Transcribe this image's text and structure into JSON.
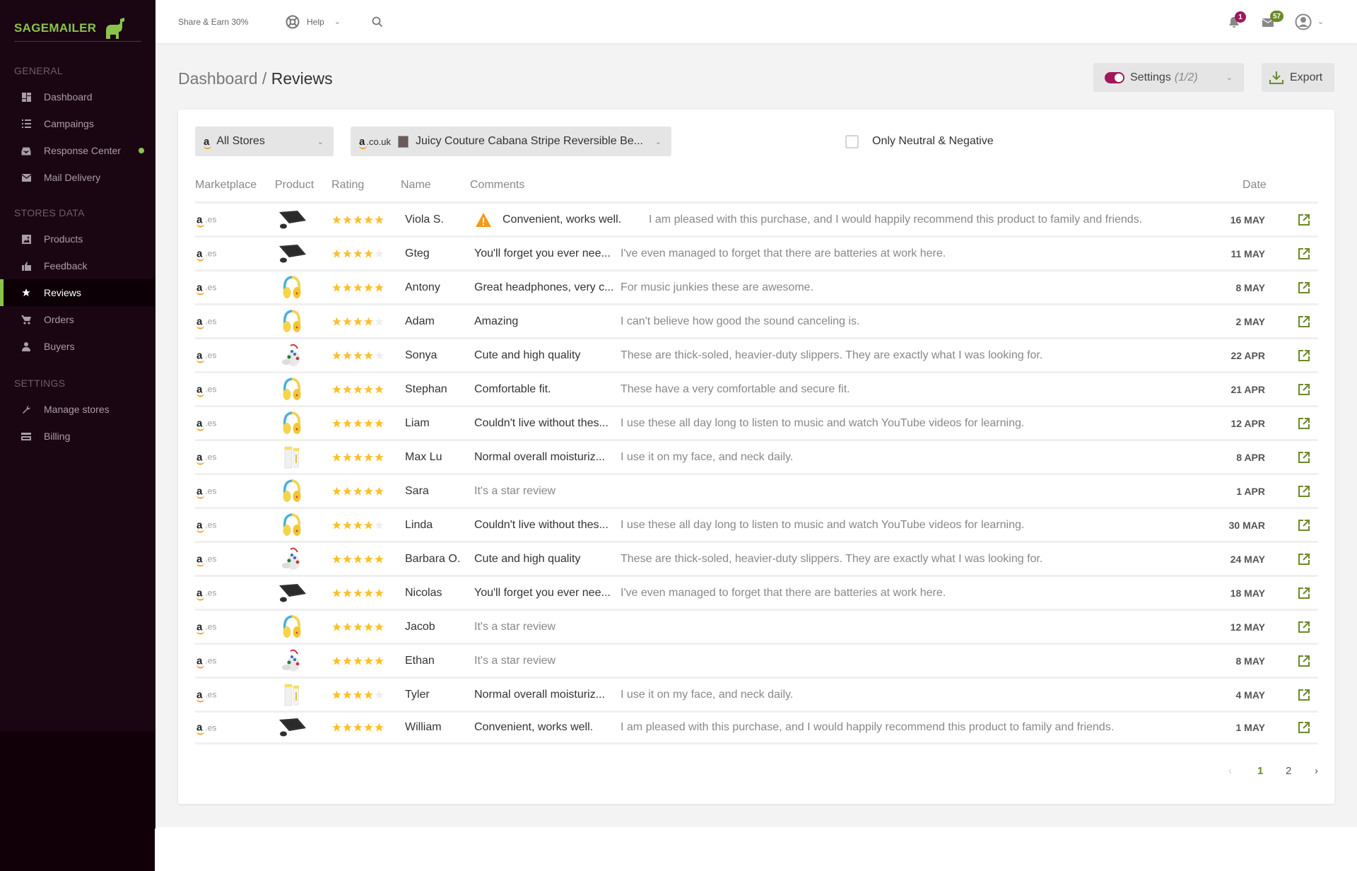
{
  "app": {
    "brand": "SAGEMAILER"
  },
  "sidebar": {
    "sections": [
      {
        "label": "GENERAL",
        "items": [
          {
            "label": "Dashboard",
            "icon": "dashboard-icon"
          },
          {
            "label": "Campaings",
            "icon": "list-icon"
          },
          {
            "label": "Response Center",
            "icon": "inbox-icon",
            "status_dot": true
          },
          {
            "label": "Mail Delivery",
            "icon": "mail-icon"
          }
        ]
      },
      {
        "label": "STORES DATA",
        "items": [
          {
            "label": "Products",
            "icon": "image-icon"
          },
          {
            "label": "Feedback",
            "icon": "thumbs-up-icon"
          },
          {
            "label": "Reviews",
            "icon": "star-icon",
            "active": true
          },
          {
            "label": "Orders",
            "icon": "cart-icon"
          },
          {
            "label": "Buyers",
            "icon": "person-icon"
          }
        ]
      },
      {
        "label": "SETTINGS",
        "items": [
          {
            "label": "Manage stores",
            "icon": "wrench-icon"
          },
          {
            "label": "Billing",
            "icon": "credit-card-icon"
          }
        ]
      }
    ]
  },
  "topbar": {
    "share_label": "Share & Earn 30%",
    "help_label": "Help",
    "notifications_count": "1",
    "messages_count": "57",
    "colors": {
      "notifications_badge": "#a0185a",
      "messages_badge": "#6a8a2a"
    }
  },
  "header": {
    "breadcrumb_parent": "Dashboard",
    "separator": " / ",
    "page_title": "Reviews",
    "settings_label": "Settings",
    "settings_count": "(1/2)",
    "settings_toggle_on": true,
    "export_label": "Export"
  },
  "filters": {
    "store_select": {
      "value": "All Stores"
    },
    "product_select": {
      "marketplace": ".co.uk",
      "value": "Juicy Couture Cabana Stripe Reversible Be..."
    },
    "only_neutral_negative": {
      "label": "Only Neutral & Negative",
      "checked": false
    }
  },
  "table": {
    "columns": [
      "Marketplace",
      "Product",
      "Rating",
      "Name",
      "Comments",
      "Date"
    ],
    "rows": [
      {
        "tld": ".es",
        "product": "keyboard",
        "rating": 5,
        "name": "Viola S.",
        "title": "Convenient, works well.",
        "comment": "I am pleased with this purchase, and I would happily recommend this product to family and friends.",
        "date": "16 MAY",
        "warning": true
      },
      {
        "tld": ".es",
        "product": "keyboard",
        "rating": 4,
        "name": "Gteg",
        "title": "You'll forget you ever nee...",
        "comment": "I've even managed to forget that there are batteries at work here.",
        "date": "11 MAY"
      },
      {
        "tld": ".es",
        "product": "headphones",
        "rating": 5,
        "name": "Antony",
        "title": "Great headphones, very c...",
        "comment": "For music junkies these are awesome.",
        "date": "8 MAY"
      },
      {
        "tld": ".es",
        "product": "headphones",
        "rating": 4,
        "name": "Adam",
        "title": "Amazing",
        "comment": "I can't believe how good the sound canceling is.",
        "date": "2 MAY"
      },
      {
        "tld": ".es",
        "product": "slippers",
        "rating": 4,
        "name": "Sonya",
        "title": "Cute and high quality",
        "comment": "These are thick-soled, heavier-duty slippers. They are exactly what I was looking for.",
        "date": "22 APR"
      },
      {
        "tld": ".es",
        "product": "headphones",
        "rating": 5,
        "name": "Stephan",
        "title": "Comfortable fit.",
        "comment": "These have a very comfortable and secure fit.",
        "date": "21 APR"
      },
      {
        "tld": ".es",
        "product": "headphones",
        "rating": 5,
        "name": "Liam",
        "title": "Couldn't live without thes...",
        "comment": "I use these all day long to listen to music and watch YouTube videos for learning.",
        "date": "12 APR"
      },
      {
        "tld": ".es",
        "product": "cream",
        "rating": 5,
        "name": "Max Lu",
        "title": "Normal overall moisturiz...",
        "comment": "I use it on my face, and neck daily.",
        "date": "8 APR"
      },
      {
        "tld": ".es",
        "product": "headphones",
        "rating": 5,
        "name": "Sara",
        "title": "It's a star review",
        "comment": "",
        "date": "1 APR",
        "light_title": true
      },
      {
        "tld": ".es",
        "product": "headphones",
        "rating": 4,
        "name": "Linda",
        "title": "Couldn't live without thes...",
        "comment": "I use these all day long to listen to music and watch YouTube videos for learning.",
        "date": "30 MAR"
      },
      {
        "tld": ".es",
        "product": "slippers",
        "rating": 5,
        "name": "Barbara O.",
        "title": "Cute and high quality",
        "comment": "These are thick-soled, heavier-duty slippers. They are exactly what I was looking for.",
        "date": "24 MAY"
      },
      {
        "tld": ".es",
        "product": "keyboard",
        "rating": 5,
        "name": "Nicolas",
        "title": "You'll forget you ever nee...",
        "comment": "I've even managed to forget that there are batteries at work here.",
        "date": "18 MAY"
      },
      {
        "tld": ".es",
        "product": "headphones",
        "rating": 5,
        "name": "Jacob",
        "title": "It's a star review",
        "comment": "",
        "date": "12 MAY",
        "light_title": true
      },
      {
        "tld": ".es",
        "product": "slippers",
        "rating": 5,
        "name": "Ethan",
        "title": "It's a star review",
        "comment": "",
        "date": "8 MAY",
        "light_title": true
      },
      {
        "tld": ".es",
        "product": "cream",
        "rating": 4,
        "name": "Tyler",
        "title": "Normal overall moisturiz...",
        "comment": "I use it on my face, and neck daily.",
        "date": "4 MAY"
      },
      {
        "tld": ".es",
        "product": "keyboard",
        "rating": 5,
        "name": "William",
        "title": "Convenient, works well.",
        "comment": "I am pleased with this purchase, and I would happily recommend this product to family and friends.",
        "date": "1 MAY"
      }
    ]
  },
  "pagination": {
    "pages": [
      "1",
      "2"
    ],
    "current": "1",
    "prev_disabled": true
  },
  "colors": {
    "accent": "#8bc34a",
    "star": "#fbc02d",
    "star_empty": "#eeeeee",
    "toggle": "#a0185a",
    "link_icon": "#6a8a2a",
    "sidebar_bg": "#1a0512"
  }
}
